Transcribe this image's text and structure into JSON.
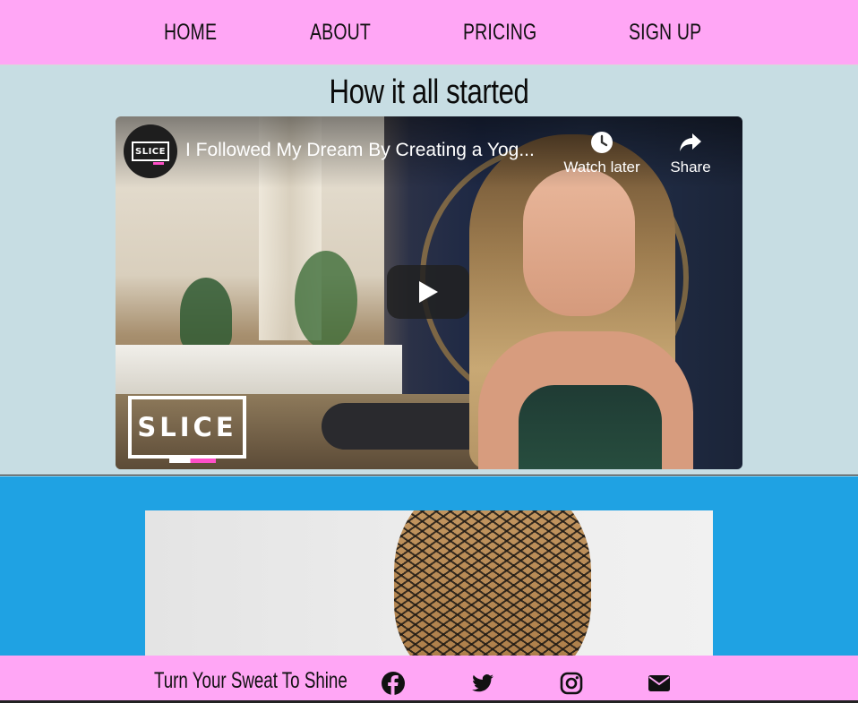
{
  "nav": {
    "items": [
      {
        "label": "HOME"
      },
      {
        "label": "ABOUT"
      },
      {
        "label": "PRICING"
      },
      {
        "label": "SIGN UP"
      }
    ]
  },
  "story": {
    "heading": "How it all started",
    "video": {
      "channel_logo_text": "SLICE",
      "title": "I Followed My Dream By Creating a Yog...",
      "watch_later_label": "Watch later",
      "share_label": "Share",
      "watermark_text": "SLICE",
      "play_icon": "play-icon",
      "watch_later_icon": "clock-icon",
      "share_icon": "share-arrow-icon"
    }
  },
  "footer": {
    "tagline": "Turn Your Sweat To Shine",
    "social_icons": [
      "facebook-icon",
      "twitter-icon",
      "instagram-icon",
      "envelope-icon"
    ]
  },
  "colors": {
    "nav_bg": "#ffa6f5",
    "story_bg": "#c7dde3",
    "gallery_bg": "#1fa2e3",
    "footer_bg": "#ffa6f5",
    "accent_pink": "#ff4fc8"
  }
}
